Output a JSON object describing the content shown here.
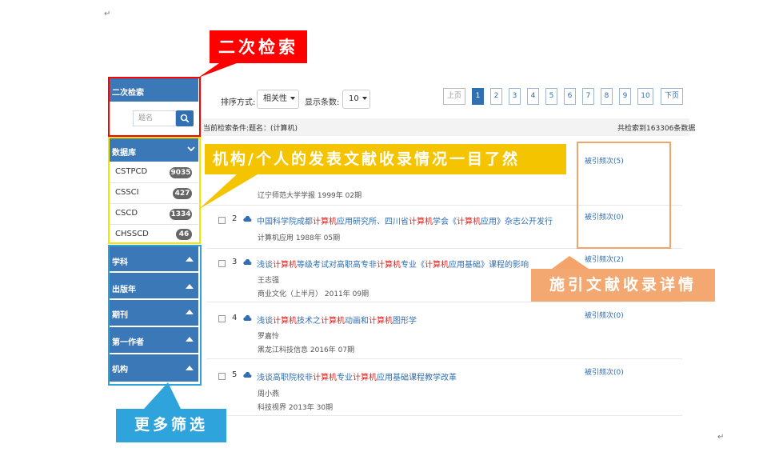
{
  "doc_marks": {
    "top_left": "↵",
    "bottom_right": "↵"
  },
  "sidebar": {
    "secondary_search": {
      "title": "二次检索",
      "placeholder": "题名"
    },
    "database": {
      "title": "数据库",
      "items": [
        {
          "name": "CSTPCD",
          "count": "9035"
        },
        {
          "name": "CSSCI",
          "count": "427"
        },
        {
          "name": "CSCD",
          "count": "1334"
        },
        {
          "name": "CHSSCD",
          "count": "46"
        }
      ]
    },
    "facets": [
      "学科",
      "出版年",
      "期刊",
      "第一作者",
      "机构"
    ]
  },
  "toolbar": {
    "sort_label": "排序方式:",
    "sort_value": "相关性",
    "count_label": "显示条数:",
    "count_value": "10"
  },
  "pagination": {
    "prev": "上页",
    "pages": [
      "1",
      "2",
      "3",
      "4",
      "5",
      "6",
      "7",
      "8",
      "9",
      "10"
    ],
    "next": "下页",
    "active": "1"
  },
  "search_conditions": "当前检索条件:题名：(计算机)",
  "total_found": "共检索到163306条数据",
  "results": [
    {
      "num": "1",
      "title": [],
      "meta": [],
      "source": "辽宁师范大学学报 1999年 02期",
      "cite": "被引频次(5)"
    },
    {
      "num": "2",
      "title": [
        {
          "t": "中国科学院成都",
          "hl": false
        },
        {
          "t": "计算机",
          "hl": true
        },
        {
          "t": "应用研究所、四川省",
          "hl": false
        },
        {
          "t": "计算机",
          "hl": true
        },
        {
          "t": "学会《",
          "hl": false
        },
        {
          "t": "计算机",
          "hl": true
        },
        {
          "t": "应用》杂志公开发行",
          "hl": false
        }
      ],
      "source": "计算机应用 1988年 05期",
      "cite": "被引频次(0)"
    },
    {
      "num": "3",
      "title": [
        {
          "t": "浅谈",
          "hl": false
        },
        {
          "t": "计算机",
          "hl": true
        },
        {
          "t": "等级考试对高职高专非",
          "hl": false
        },
        {
          "t": "计算机",
          "hl": true
        },
        {
          "t": "专业《",
          "hl": false
        },
        {
          "t": "计算机",
          "hl": true
        },
        {
          "t": "应用基础》课程的影响",
          "hl": false
        }
      ],
      "author": "王志强",
      "source": "商业文化（上半月） 2011年 09期",
      "cite": "被引频次(2)"
    },
    {
      "num": "4",
      "title": [
        {
          "t": "浅谈",
          "hl": false
        },
        {
          "t": "计算机",
          "hl": true
        },
        {
          "t": "技术之",
          "hl": false
        },
        {
          "t": "计算机",
          "hl": true
        },
        {
          "t": "动画和",
          "hl": false
        },
        {
          "t": "计算机",
          "hl": true
        },
        {
          "t": "图形学",
          "hl": false
        }
      ],
      "author": "罗嘉怜",
      "source": "黑龙江科技信息 2016年 07期",
      "cite": "被引频次(0)"
    },
    {
      "num": "5",
      "title": [
        {
          "t": "浅谈高职院校非",
          "hl": false
        },
        {
          "t": "计算机",
          "hl": true
        },
        {
          "t": "专业",
          "hl": false
        },
        {
          "t": "计算机",
          "hl": true
        },
        {
          "t": "应用基础课程教学改革",
          "hl": false
        }
      ],
      "author": "周小燕",
      "source": "科技视界 2013年 30期",
      "cite": "被引频次(0)"
    }
  ],
  "callouts": {
    "secondary_search": "二次检索",
    "institution": "机构/个人的发表文献收录情况一目了然",
    "citation": "施引文献收录详情",
    "more_filters": "更多筛选"
  },
  "colors": {
    "primary_blue": "#3a78b8",
    "highlight_red": "#e0201b",
    "box_red": "#ff0000",
    "box_yellow": "#f5e400",
    "box_orange": "#f4a46a",
    "box_cyan": "#2ea3dc"
  }
}
